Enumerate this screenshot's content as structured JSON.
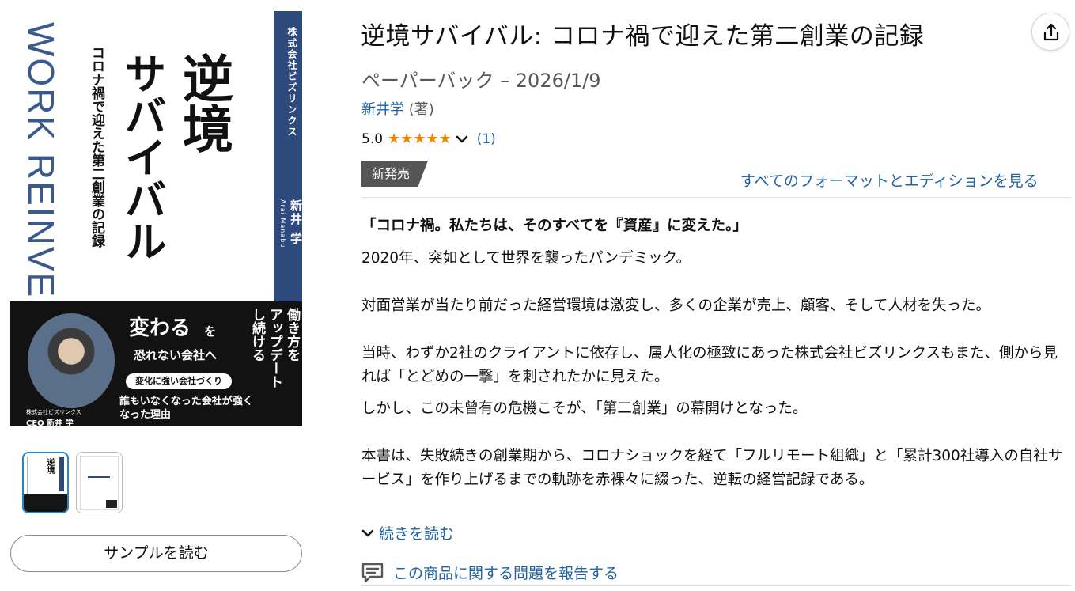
{
  "cover": {
    "work_text": "WORK REINVENTED",
    "title_line1": "逆境",
    "title_line2": "サバイバル",
    "subtitle": "コロナ禍で迎えた第二創業の記録",
    "publisher": "株式会社ビズリンクス",
    "author": "新井 学",
    "author_roman": "Arai Manabu",
    "big_text": "変わる",
    "big_text_suffix": "を",
    "line2": "恐れない会社へ",
    "pill": "変化に強い会社づくり",
    "line3": "誰もいなくなった会社が強くなった理由",
    "ceo_org": "株式会社ビズリンクス",
    "ceo": "CEO 新井 学",
    "vertical_copy": "働き方を\nアップデート\nし続ける"
  },
  "sample_button": "サンプルを読む",
  "title": "逆境サバイバル: コロナ禍で迎えた第二創業の記録",
  "format": "ペーパーバック – 2026/1/9",
  "author": {
    "name": "新井学",
    "role": "(著)"
  },
  "rating": {
    "value": "5.0",
    "stars": "★★★★★",
    "count": "(1)",
    "score": 5,
    "max": 5
  },
  "badge": "新発売",
  "all_formats_link": "すべてのフォーマットとエディションを見る",
  "description": {
    "headline": "「コロナ禍。私たちは、そのすべてを『資産』に変えた。」",
    "p1": "2020年、突如として世界を襲ったパンデミック。",
    "p2": "対面営業が当たり前だった経営環境は激変し、多くの企業が売上、顧客、そして人材を失った。",
    "p3": "当時、わずか2社のクライアントに依存し、属人化の極致にあった株式会社ビズリンクスもまた、側から見れば「とどめの一撃」を刺されたかに見えた。",
    "p4": "しかし、この未曾有の危機こそが、「第二創業」の幕開けとなった。",
    "p5": "本書は、失敗続きの創業期から、コロナショックを経て「フルリモート組織」と「累計300社導入の自社サービス」を作り上げるまでの軌跡を赤裸々に綴った、逆転の経営記録である。"
  },
  "read_more": "続きを読む",
  "report_link": "この商品に関する問題を報告する",
  "colors": {
    "link": "#2162a1",
    "star": "#f08804",
    "badge_bg": "#555555",
    "cover_blue": "#2e4a7c"
  },
  "icons": [
    "share-icon",
    "chevron-down-icon",
    "report-icon"
  ]
}
